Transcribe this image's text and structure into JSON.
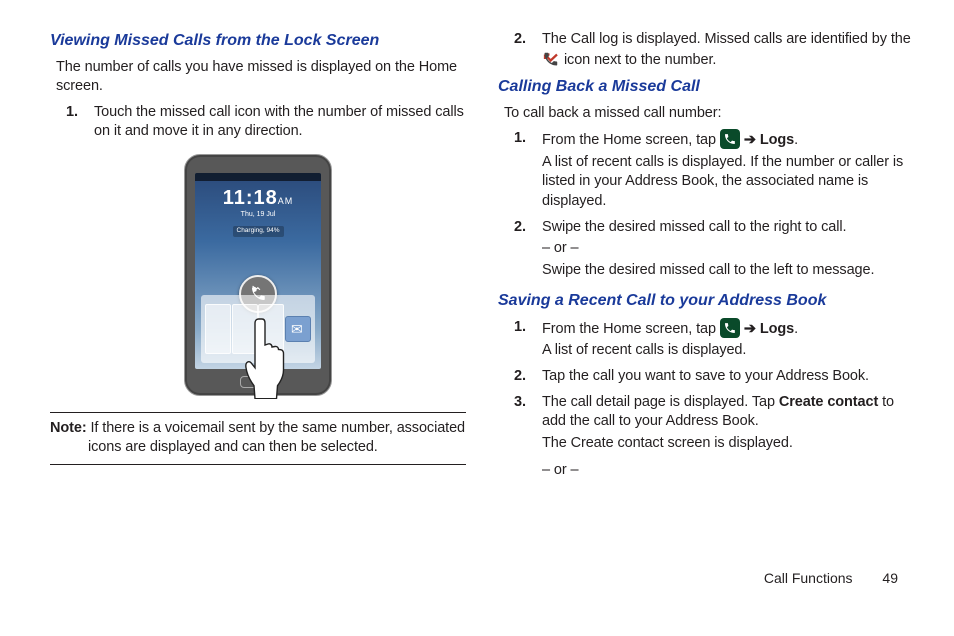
{
  "left": {
    "h1": "Viewing Missed Calls from the Lock Screen",
    "p1": "The number of calls you have missed is displayed on the Home screen.",
    "li1": "Touch the missed call icon with the number of missed calls on it and move it in any direction.",
    "phone": {
      "time": "11:18",
      "ampm": "AM",
      "date": "Thu, 19 Jul",
      "charge": "Charging, 94%"
    },
    "note_label": "Note:",
    "note": "If there is a voicemail sent by the same number, associated icons are displayed and can then be selected."
  },
  "right": {
    "li2a": "The Call log is displayed. Missed calls are identified by the ",
    "li2b": " icon next to the number.",
    "h2": "Calling Back a Missed Call",
    "p2": "To call back a missed call number:",
    "s2_li1a": "From the Home screen, tap ",
    "arrow": "➔",
    "logs": "Logs",
    "s2_li1b": "A list of recent calls is displayed. If the number or caller is listed in your Address Book, the associated name is displayed.",
    "s2_li2a": "Swipe the desired missed call to the right to call.",
    "or": "– or –",
    "s2_li2b": "Swipe the desired missed call to the left to message.",
    "h3": "Saving a Recent Call to your Address Book",
    "s3_li1a": "From the Home screen, tap ",
    "s3_li1b": "A list of recent calls is displayed.",
    "s3_li2": "Tap the call you want to save to your Address Book.",
    "s3_li3a": "The call detail page is displayed. Tap ",
    "create_contact": "Create contact",
    "s3_li3b": " to add the call to your Address Book.",
    "s3_li3c": "The Create contact screen is displayed."
  },
  "footer": {
    "section": "Call Functions",
    "page": "49"
  }
}
